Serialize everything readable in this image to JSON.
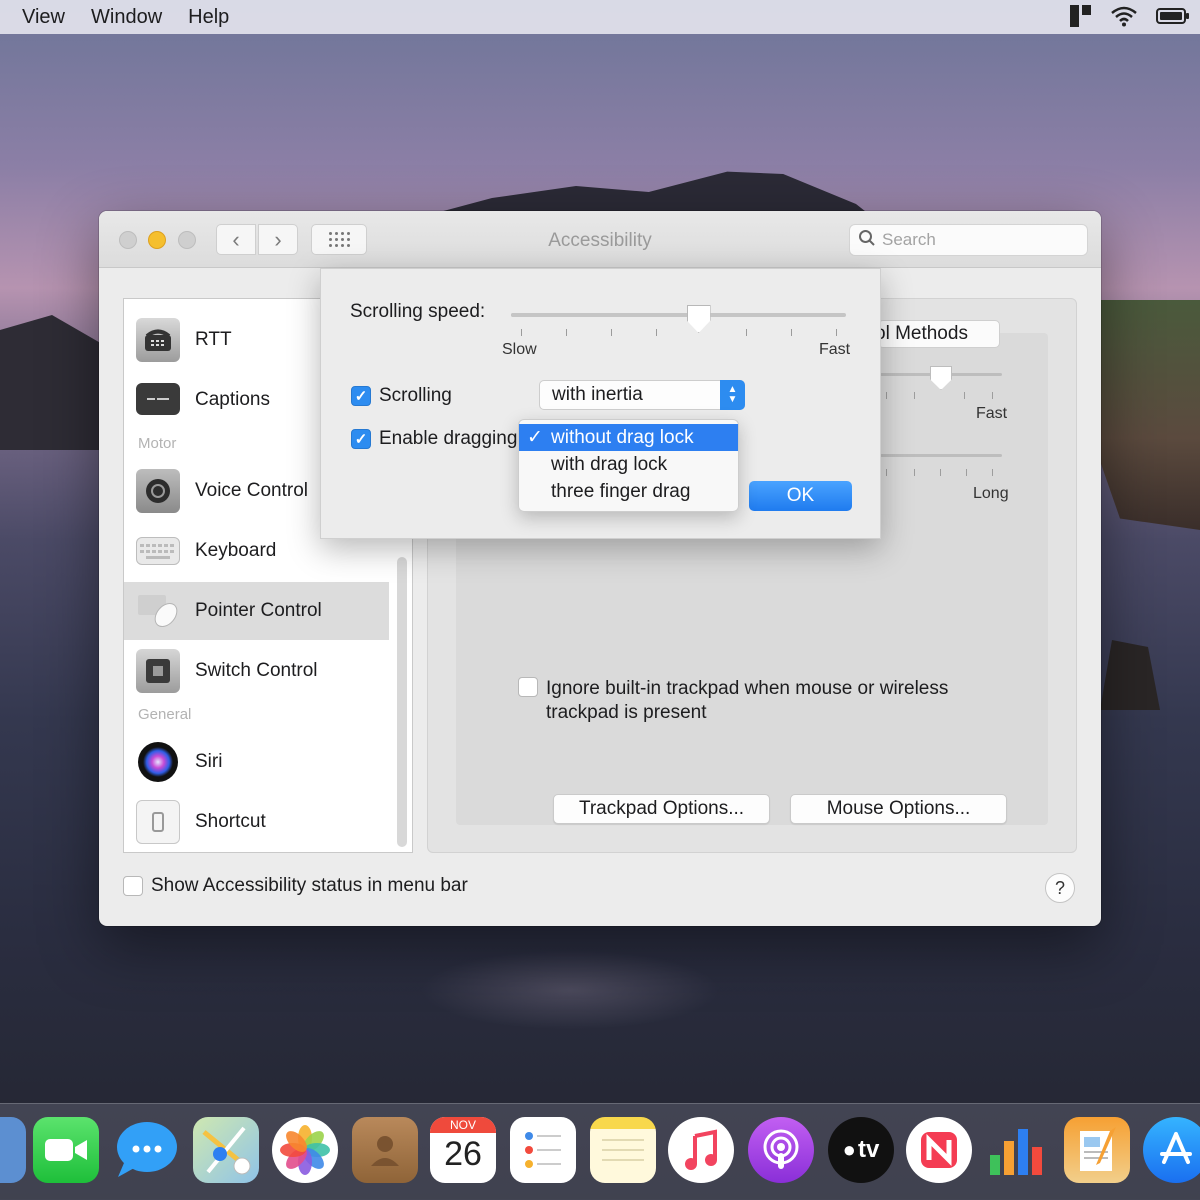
{
  "menubar": {
    "items": [
      "View",
      "Window",
      "Help"
    ]
  },
  "window": {
    "title": "Accessibility",
    "search_placeholder": "Search"
  },
  "sidebar": {
    "items": [
      {
        "label": "RTT",
        "icon": "rtt-phone-icon"
      },
      {
        "label": "Captions",
        "icon": "captions-icon"
      },
      {
        "label": "Voice Control",
        "icon": "voice-control-icon"
      },
      {
        "label": "Keyboard",
        "icon": "keyboard-icon"
      },
      {
        "label": "Pointer Control",
        "icon": "pointer-control-icon",
        "selected": true
      },
      {
        "label": "Switch Control",
        "icon": "switch-control-icon"
      },
      {
        "label": "Siri",
        "icon": "siri-icon"
      },
      {
        "label": "Shortcut",
        "icon": "shortcut-icon"
      }
    ],
    "sections": {
      "motor": "Motor",
      "general": "General"
    }
  },
  "main": {
    "tab_partial": "ol Methods",
    "slider_label_fast": "Fast",
    "slider_label_long": "Long",
    "ignore_trackpad_text": "Ignore built-in trackpad when mouse or wireless trackpad is present",
    "ignore_trackpad_checked": false,
    "trackpad_options": "Trackpad Options...",
    "mouse_options": "Mouse Options..."
  },
  "footer": {
    "status_label": "Show Accessibility status in menu bar",
    "status_checked": false,
    "help": "?"
  },
  "sheet": {
    "scrolling_speed_label": "Scrolling speed:",
    "scrolling_speed_value": 0.56,
    "slow": "Slow",
    "fast": "Fast",
    "scrolling_label": "Scrolling",
    "scrolling_checked": true,
    "scrolling_mode": "with inertia",
    "dragging_label": "Enable dragging",
    "dragging_checked": true,
    "ok": "OK"
  },
  "dropdown": {
    "options": [
      "without drag lock",
      "with drag lock",
      "three finger drag"
    ],
    "selected": "without drag lock",
    "check": "✓"
  },
  "dock": {
    "calendar_month": "NOV",
    "calendar_day": "26",
    "tv_label": "tv",
    "apps": [
      "preview-icon",
      "facetime-icon",
      "messages-icon",
      "maps-icon",
      "photos-icon",
      "contacts-icon",
      "calendar-icon",
      "reminders-icon",
      "notes-icon",
      "music-icon",
      "podcasts-icon",
      "apple-tv-icon",
      "news-icon",
      "numbers-icon",
      "pages-icon",
      "app-store-icon"
    ]
  },
  "colors": {
    "accent": "#2d7ff1",
    "minimize": "#f5bf2e"
  }
}
